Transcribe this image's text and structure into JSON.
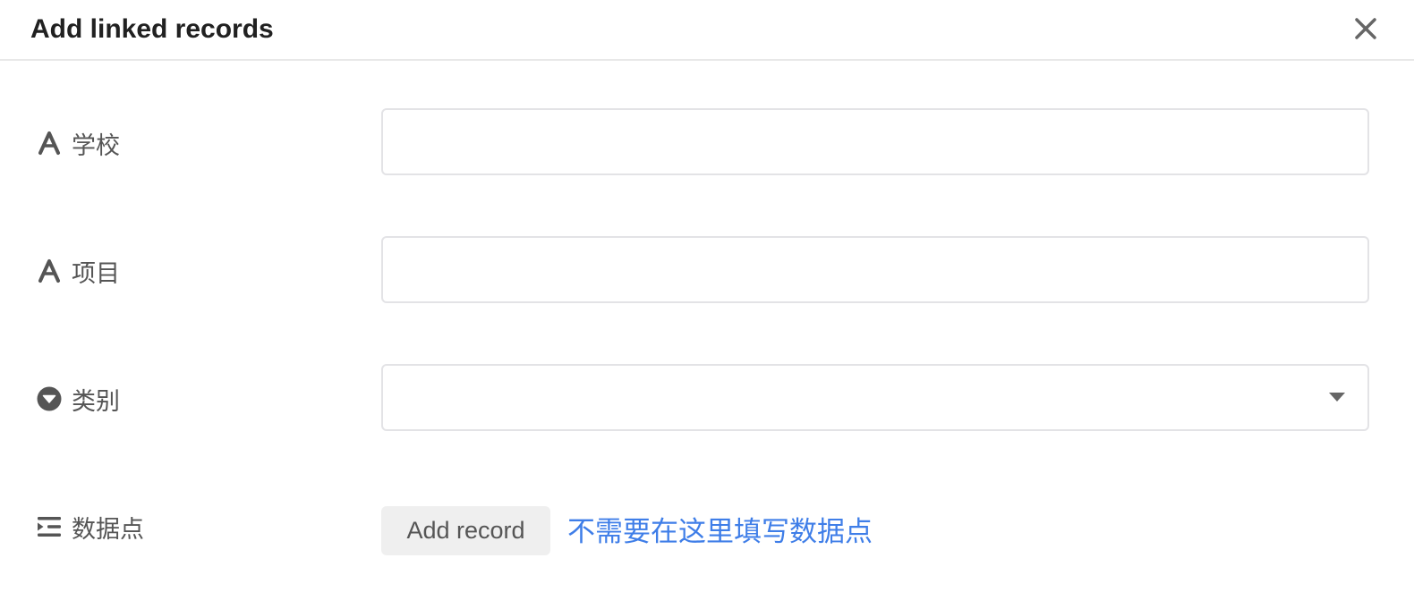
{
  "dialog": {
    "title": "Add linked records",
    "close_icon": "close-icon"
  },
  "fields": [
    {
      "label": "学校",
      "icon": "text-type-icon",
      "type": "text",
      "value": ""
    },
    {
      "label": "项目",
      "icon": "text-type-icon",
      "type": "text",
      "value": ""
    },
    {
      "label": "类别",
      "icon": "single-select-icon",
      "type": "select",
      "value": ""
    },
    {
      "label": "数据点",
      "icon": "link-record-icon",
      "type": "link"
    }
  ],
  "link_field": {
    "add_record_label": "Add record",
    "hint_text": "不需要在这里填写数据点"
  },
  "colors": {
    "link": "#3f7ee8",
    "icon": "#555555",
    "border": "#e3e3e6",
    "button_bg": "#efefef"
  }
}
